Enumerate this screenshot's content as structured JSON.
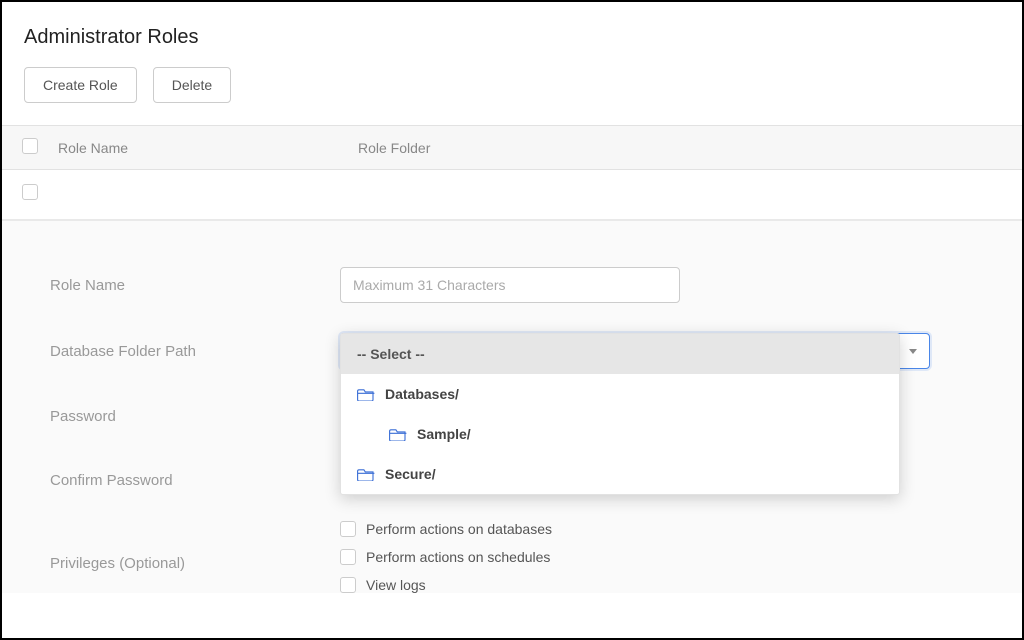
{
  "page": {
    "title": "Administrator Roles"
  },
  "toolbar": {
    "create_label": "Create Role",
    "delete_label": "Delete"
  },
  "table": {
    "col_name": "Role Name",
    "col_folder": "Role Folder"
  },
  "form": {
    "role_name_label": "Role Name",
    "role_name_placeholder": "Maximum 31 Characters",
    "folder_path_label": "Database Folder Path",
    "password_label": "Password",
    "confirm_password_label": "Confirm Password",
    "privileges_label": "Privileges (Optional)"
  },
  "dropdown": {
    "header": "-- Select --",
    "items": [
      {
        "label": "Databases/",
        "indent": false
      },
      {
        "label": "Sample/",
        "indent": true
      },
      {
        "label": "Secure/",
        "indent": false
      }
    ]
  },
  "privileges": [
    "Perform actions on databases",
    "Perform actions on schedules",
    "View logs"
  ]
}
